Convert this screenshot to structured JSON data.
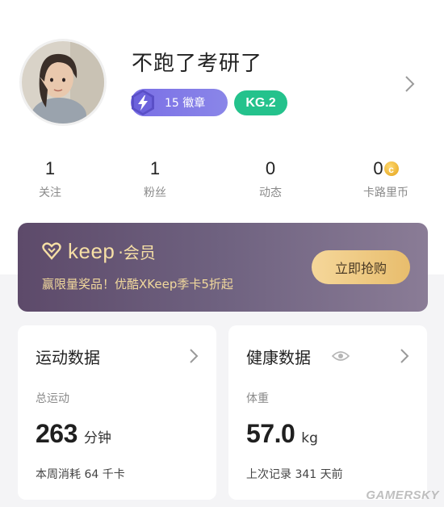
{
  "profile": {
    "username": "不跑了考研了",
    "badge_text": "15 徽章",
    "level": "KG.2"
  },
  "stats": [
    {
      "value": "1",
      "label": "关注"
    },
    {
      "value": "1",
      "label": "粉丝"
    },
    {
      "value": "0",
      "label": "动态"
    },
    {
      "value": "0",
      "label": "卡路里币"
    }
  ],
  "banner": {
    "brand": "keep",
    "brand_sub": "·会员",
    "promo": "赢限量奖品！优酷XKeep季卡5折起",
    "button": "立即抢购"
  },
  "sports_card": {
    "title": "运动数据",
    "sub": "总运动",
    "value": "263",
    "unit": "分钟",
    "foot": "本周消耗 64 千卡"
  },
  "health_card": {
    "title": "健康数据",
    "sub": "体重",
    "value": "57.0",
    "unit": "kg",
    "foot": "上次记录 341 天前"
  },
  "watermark": "GAMERSKY",
  "colors": {
    "badge": "#7a6fe6",
    "level": "#24c28c",
    "banner_gold": "#f6dfa5",
    "coin": "#e3a21a"
  }
}
